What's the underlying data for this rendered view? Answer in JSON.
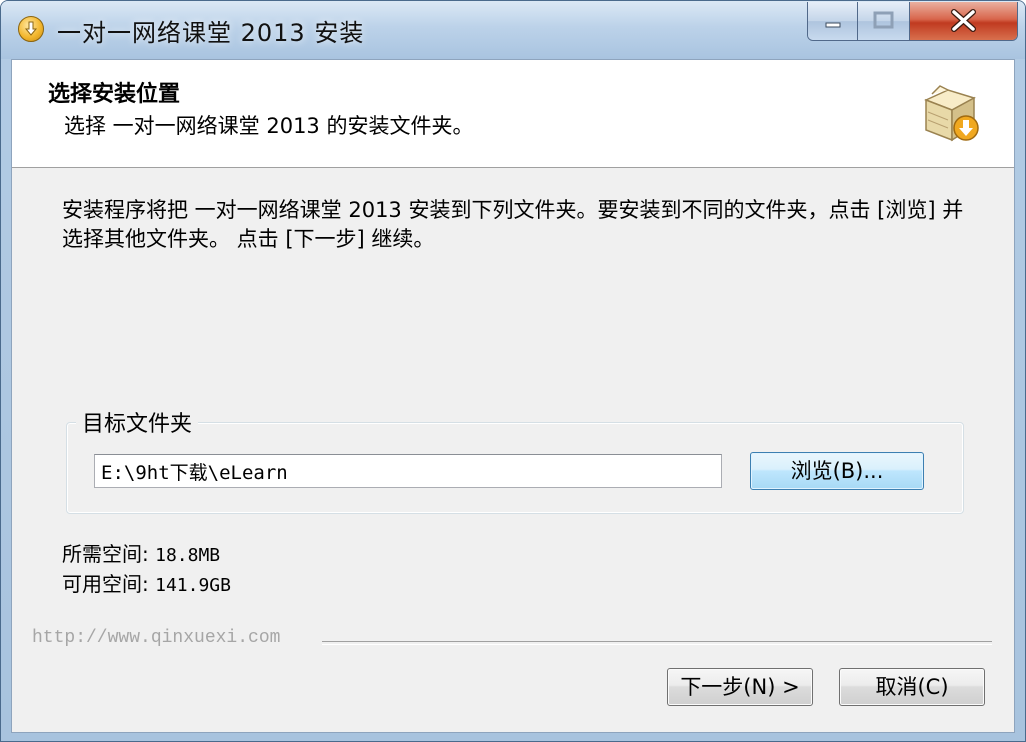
{
  "window": {
    "title": "一对一网络课堂 2013 安装",
    "icons": [
      "installer-app-icon",
      "minimize-icon",
      "maximize-icon",
      "close-icon"
    ]
  },
  "header": {
    "title": "选择安装位置",
    "subtitle": "选择 一对一网络课堂 2013 的安装文件夹。",
    "icon": "install-box-icon"
  },
  "body": {
    "description": "安装程序将把 一对一网络课堂 2013 安装到下列文件夹。要安装到不同的文件夹，点击 [浏览] 并选择其他文件夹。 点击 [下一步] 继续。",
    "destination": {
      "label": "目标文件夹",
      "path": "E:\\9ht下载\\eLearn",
      "browse_label": "浏览(B)..."
    },
    "space_required": {
      "label": "所需空间:",
      "value": "18.8MB"
    },
    "space_available": {
      "label": "可用空间:",
      "value": "141.9GB"
    }
  },
  "footer": {
    "branding": "http://www.qinxuexi.com",
    "next_label": "下一步(N) >",
    "cancel_label": "取消(C)"
  }
}
